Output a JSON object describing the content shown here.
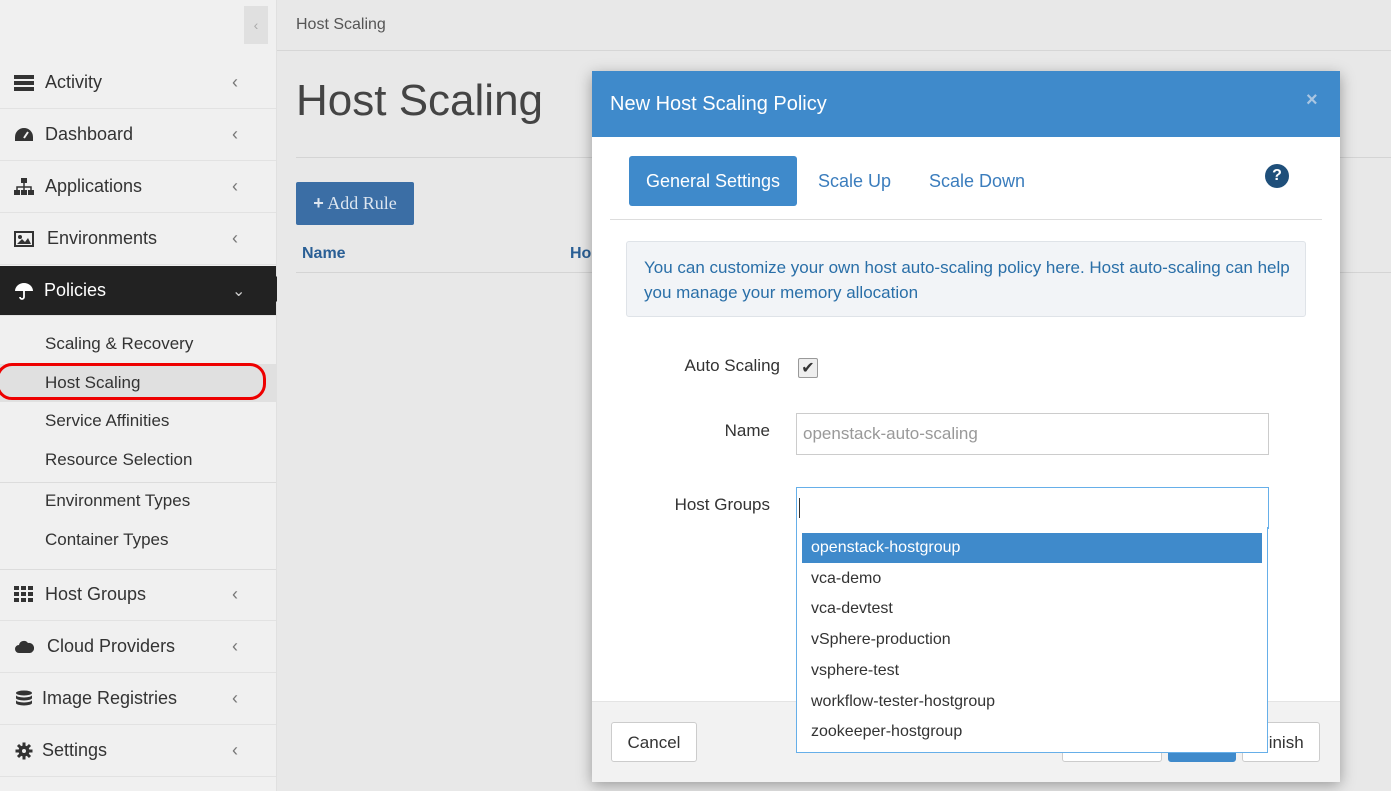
{
  "sidebar": {
    "items": [
      {
        "label": "Activity",
        "icon": "server-icon"
      },
      {
        "label": "Dashboard",
        "icon": "dashboard-icon"
      },
      {
        "label": "Applications",
        "icon": "sitemap-icon"
      },
      {
        "label": "Environments",
        "icon": "picture-icon"
      },
      {
        "label": "Policies",
        "icon": "umbrella-icon"
      },
      {
        "label": "Host Groups",
        "icon": "grid-icon"
      },
      {
        "label": "Cloud Providers",
        "icon": "cloud-icon"
      },
      {
        "label": "Image Registries",
        "icon": "database-icon"
      },
      {
        "label": "Settings",
        "icon": "gear-icon"
      }
    ],
    "policies_sub": [
      {
        "label": "Scaling & Recovery"
      },
      {
        "label": "Host Scaling"
      },
      {
        "label": "Service Affinities"
      },
      {
        "label": "Resource Selection"
      },
      {
        "label": "Environment Types"
      },
      {
        "label": "Container Types"
      }
    ]
  },
  "main": {
    "breadcrumb": "Host Scaling",
    "title": "Host Scaling",
    "add_rule_label": "Add Rule",
    "columns": [
      "Name",
      "Ho"
    ]
  },
  "modal": {
    "title": "New Host Scaling Policy",
    "close": "×",
    "tabs": [
      {
        "label": "General Settings",
        "active": true
      },
      {
        "label": "Scale Up",
        "active": false
      },
      {
        "label": "Scale Down",
        "active": false
      }
    ],
    "help": "?",
    "info": "You can customize your own host auto-scaling policy here. Host auto-scaling can help you manage your memory allocation",
    "fields": {
      "auto_scaling_label": "Auto Scaling",
      "auto_scaling_checked": true,
      "name_label": "Name",
      "name_placeholder": "openstack-auto-scaling",
      "host_groups_label": "Host Groups",
      "host_groups_value": ""
    },
    "footer": {
      "cancel": "Cancel",
      "finish": "Finish"
    }
  },
  "dropdown": {
    "options": [
      {
        "label": "openstack-hostgroup",
        "highlighted": true
      },
      {
        "label": "vca-demo"
      },
      {
        "label": "vca-devtest"
      },
      {
        "label": "vSphere-production"
      },
      {
        "label": "vsphere-test"
      },
      {
        "label": "workflow-tester-hostgroup"
      },
      {
        "label": "zookeeper-hostgroup"
      }
    ]
  },
  "colors": {
    "accent": "#3f8acb",
    "sidebar_active": "#222222",
    "annotation": "#ee0000"
  }
}
